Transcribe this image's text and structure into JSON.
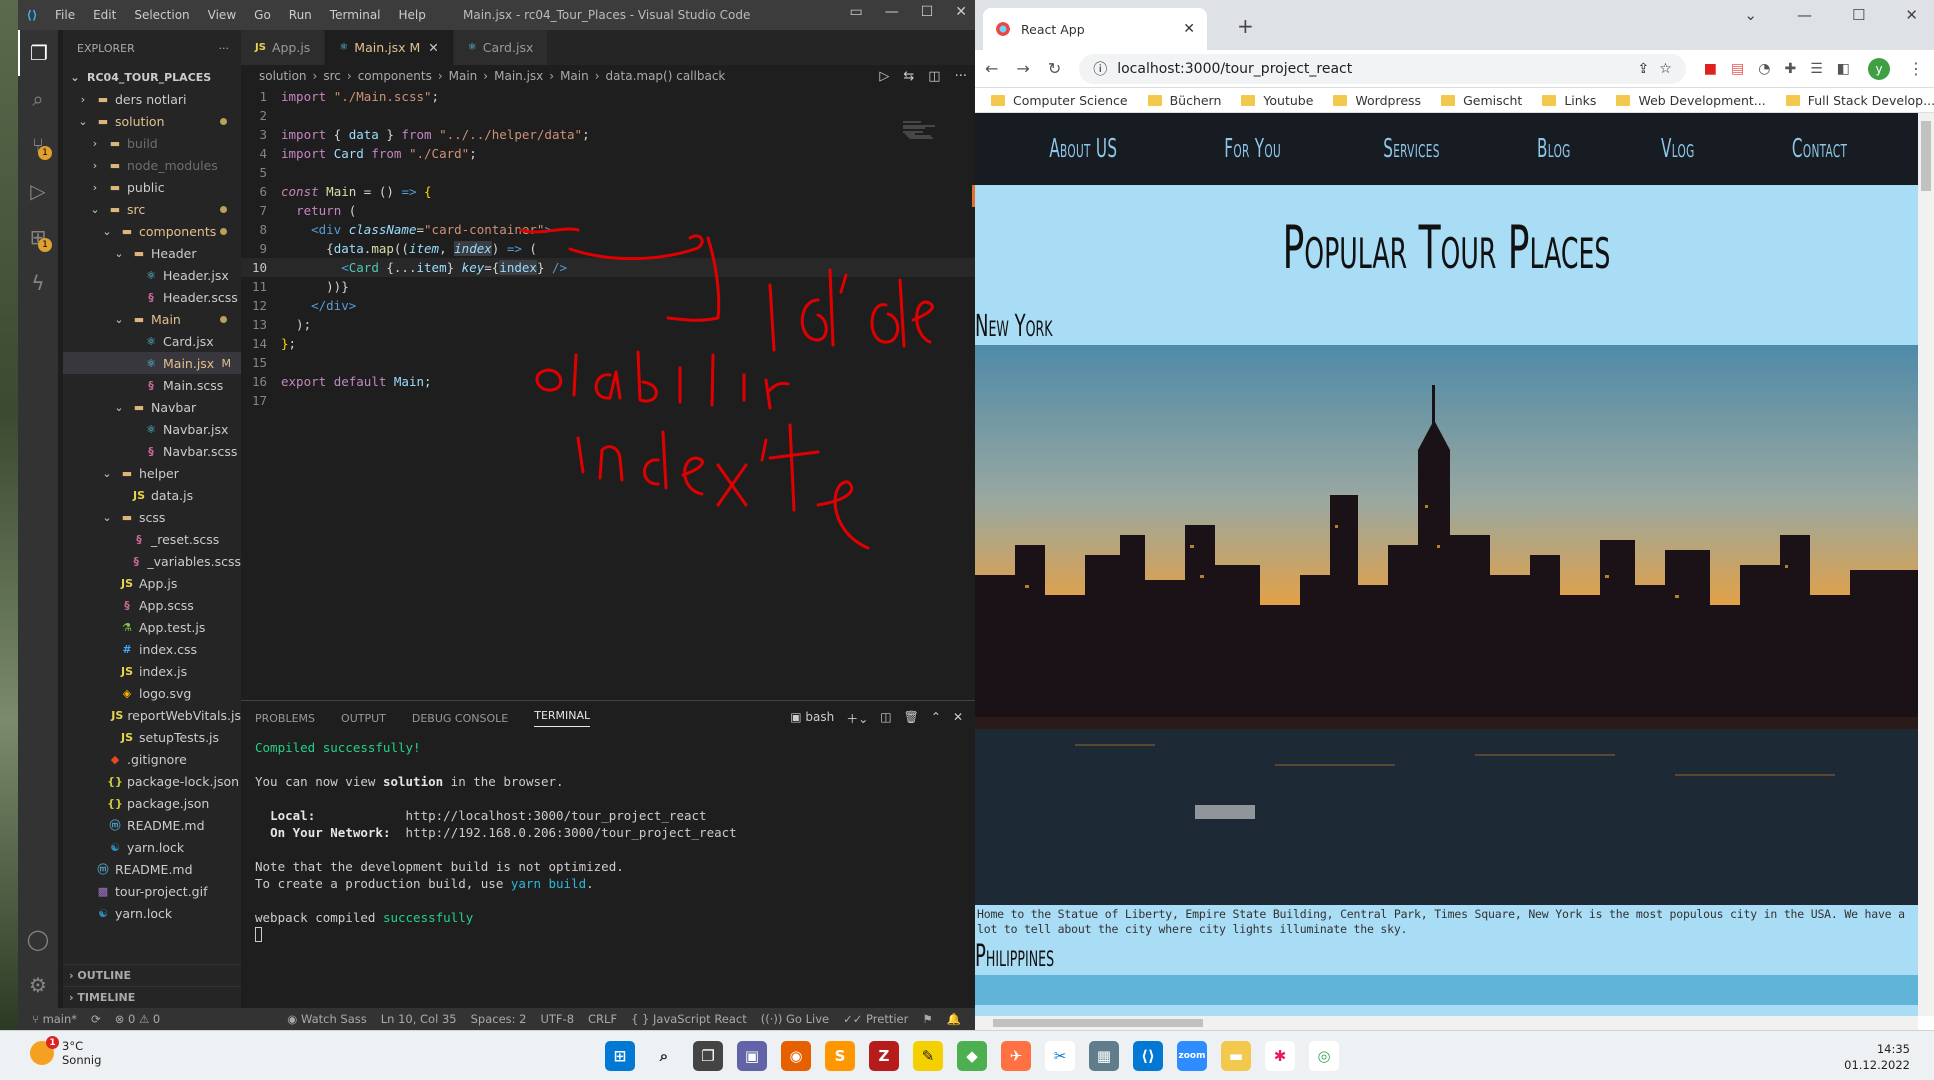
{
  "vscode": {
    "menu": [
      "File",
      "Edit",
      "Selection",
      "View",
      "Go",
      "Run",
      "Terminal",
      "Help"
    ],
    "window_title": "Main.jsx - rc04_Tour_Places - Visual Studio Code",
    "explorer_label": "EXPLORER",
    "project": "RC04_TOUR_PLACES",
    "tree": [
      {
        "label": "ders notlari",
        "depth": 1,
        "kind": "folder",
        "arrow": "›"
      },
      {
        "label": "solution",
        "depth": 1,
        "kind": "folder",
        "arrow": "⌄",
        "dot": true,
        "mod": true
      },
      {
        "label": "build",
        "depth": 2,
        "kind": "folder",
        "arrow": "›",
        "dim": true
      },
      {
        "label": "node_modules",
        "depth": 2,
        "kind": "folder",
        "arrow": "›",
        "dim": true
      },
      {
        "label": "public",
        "depth": 2,
        "kind": "folder",
        "arrow": "›"
      },
      {
        "label": "src",
        "depth": 2,
        "kind": "folder",
        "arrow": "⌄",
        "dot": true,
        "mod": true
      },
      {
        "label": "components",
        "depth": 3,
        "kind": "folder",
        "arrow": "⌄",
        "dot": true,
        "mod": true
      },
      {
        "label": "Header",
        "depth": 4,
        "kind": "folder",
        "arrow": "⌄"
      },
      {
        "label": "Header.jsx",
        "depth": 5,
        "kind": "react"
      },
      {
        "label": "Header.scss",
        "depth": 5,
        "kind": "scss"
      },
      {
        "label": "Main",
        "depth": 4,
        "kind": "folder",
        "arrow": "⌄",
        "dot": true,
        "mod": true
      },
      {
        "label": "Card.jsx",
        "depth": 5,
        "kind": "react"
      },
      {
        "label": "Main.jsx",
        "depth": 5,
        "kind": "react",
        "sel": true,
        "m": "M",
        "mod": true
      },
      {
        "label": "Main.scss",
        "depth": 5,
        "kind": "scss"
      },
      {
        "label": "Navbar",
        "depth": 4,
        "kind": "folder",
        "arrow": "⌄"
      },
      {
        "label": "Navbar.jsx",
        "depth": 5,
        "kind": "react"
      },
      {
        "label": "Navbar.scss",
        "depth": 5,
        "kind": "scss"
      },
      {
        "label": "helper",
        "depth": 3,
        "kind": "folder",
        "arrow": "⌄"
      },
      {
        "label": "data.js",
        "depth": 4,
        "kind": "js"
      },
      {
        "label": "scss",
        "depth": 3,
        "kind": "folder",
        "arrow": "⌄"
      },
      {
        "label": "_reset.scss",
        "depth": 4,
        "kind": "scss"
      },
      {
        "label": "_variables.scss",
        "depth": 4,
        "kind": "scss"
      },
      {
        "label": "App.js",
        "depth": 3,
        "kind": "js"
      },
      {
        "label": "App.scss",
        "depth": 3,
        "kind": "scss"
      },
      {
        "label": "App.test.js",
        "depth": 3,
        "kind": "test"
      },
      {
        "label": "index.css",
        "depth": 3,
        "kind": "css"
      },
      {
        "label": "index.js",
        "depth": 3,
        "kind": "js"
      },
      {
        "label": "logo.svg",
        "depth": 3,
        "kind": "svg"
      },
      {
        "label": "reportWebVitals.js",
        "depth": 3,
        "kind": "js"
      },
      {
        "label": "setupTests.js",
        "depth": 3,
        "kind": "js"
      },
      {
        "label": ".gitignore",
        "depth": 2,
        "kind": "git"
      },
      {
        "label": "package-lock.json",
        "depth": 2,
        "kind": "json"
      },
      {
        "label": "package.json",
        "depth": 2,
        "kind": "json"
      },
      {
        "label": "README.md",
        "depth": 2,
        "kind": "md"
      },
      {
        "label": "yarn.lock",
        "depth": 2,
        "kind": "yarn"
      },
      {
        "label": "README.md",
        "depth": 1,
        "kind": "md"
      },
      {
        "label": "tour-project.gif",
        "depth": 1,
        "kind": "gif"
      },
      {
        "label": "yarn.lock",
        "depth": 1,
        "kind": "yarn"
      }
    ],
    "outline": "OUTLINE",
    "timeline": "TIMELINE",
    "tabs": [
      {
        "label": "App.js",
        "icon": "JS"
      },
      {
        "label": "Main.jsx",
        "suffix": "M",
        "active": true
      },
      {
        "label": "Card.jsx"
      }
    ],
    "breadcrumb": [
      "solution",
      "src",
      "components",
      "Main",
      "Main.jsx",
      "Main",
      "data.map() callback"
    ],
    "cursor_line": 10,
    "panel_tabs": [
      "PROBLEMS",
      "OUTPUT",
      "DEBUG CONSOLE",
      "TERMINAL"
    ],
    "shell": "bash",
    "terminal": {
      "compiled": "Compiled successfully!",
      "view_pre": "You can now view ",
      "view_app": "solution",
      "view_post": " in the browser.",
      "local_label": "Local:",
      "local_url": "http://localhost:3000/tour_project_react",
      "net_label": "On Your Network:",
      "net_url": "http://192.168.0.206:3000/tour_project_react",
      "note1": "Note that the development build is not optimized.",
      "note2_pre": "To create a production build, use ",
      "note2_cmd": "yarn build",
      "note2_post": ".",
      "wp_pre": "webpack compiled ",
      "wp_post": "successfully"
    },
    "status": {
      "branch": "main*",
      "errors": "⊗ 0 ⚠ 0",
      "watch": "Watch Sass",
      "pos": "Ln 10, Col 35",
      "spaces": "Spaces: 2",
      "enc": "UTF-8",
      "eol": "CRLF",
      "lang": "JavaScript React",
      "live": "Go Live",
      "prettier": "Prettier"
    },
    "annotation_lines": [
      "id'de",
      "olabilir",
      "index'te"
    ],
    "accent": "#007acc"
  },
  "browser": {
    "tab_title": "React App",
    "url": "localhost:3000/tour_project_react",
    "bookmarks": [
      "Computer Science",
      "Büchern",
      "Youtube",
      "Wordpress",
      "Gemischt",
      "Links",
      "Web Development...",
      "Full Stack Develop..."
    ],
    "avatar": "y",
    "nav": [
      "About US",
      "For You",
      "Services",
      "Blog",
      "Vlog",
      "Contact"
    ],
    "page_title": "Popular Tour Places",
    "city1": "New York",
    "desc1": "Home to the Statue of Liberty, Empire State Building, Central Park, Times Square, New York is the most populous city in the USA. We have a lot to tell about the city where city lights illuminate the sky.",
    "city2": "Philippines"
  },
  "taskbar": {
    "temp": "3°C",
    "weather": "Sonnig",
    "badge": "1",
    "time": "14:35",
    "date": "01.12.2022"
  }
}
